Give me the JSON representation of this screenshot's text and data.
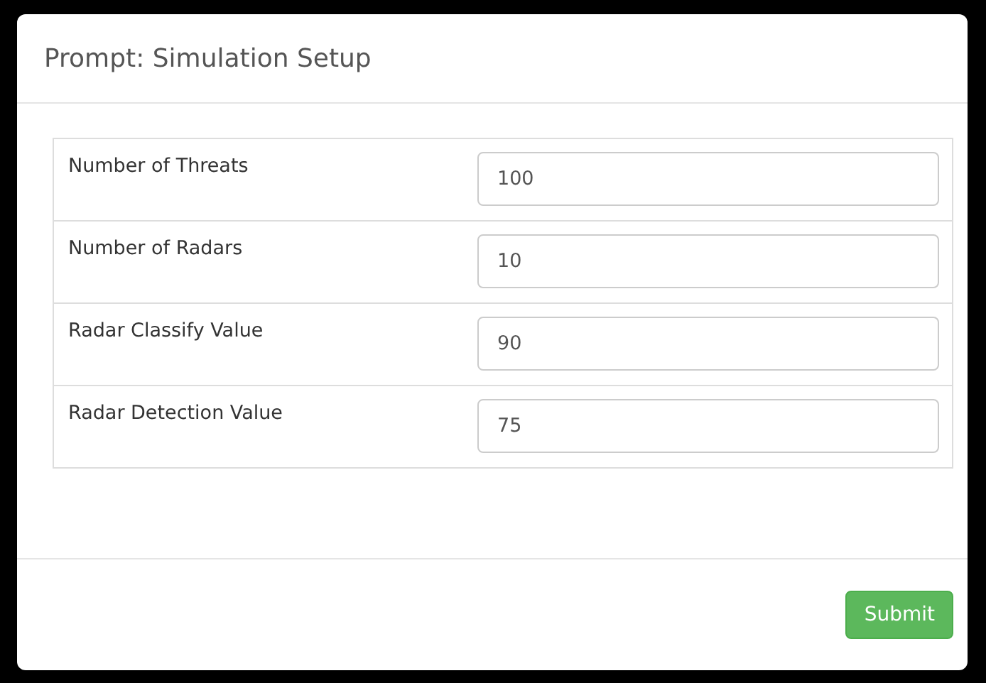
{
  "dialog": {
    "title": "Prompt: Simulation Setup"
  },
  "fields": [
    {
      "label": "Number of Threats",
      "value": "100"
    },
    {
      "label": "Number of Radars",
      "value": "10"
    },
    {
      "label": "Radar Classify Value",
      "value": "90"
    },
    {
      "label": "Radar Detection Value",
      "value": "75"
    }
  ],
  "buttons": [
    {
      "label": "Submit"
    }
  ]
}
